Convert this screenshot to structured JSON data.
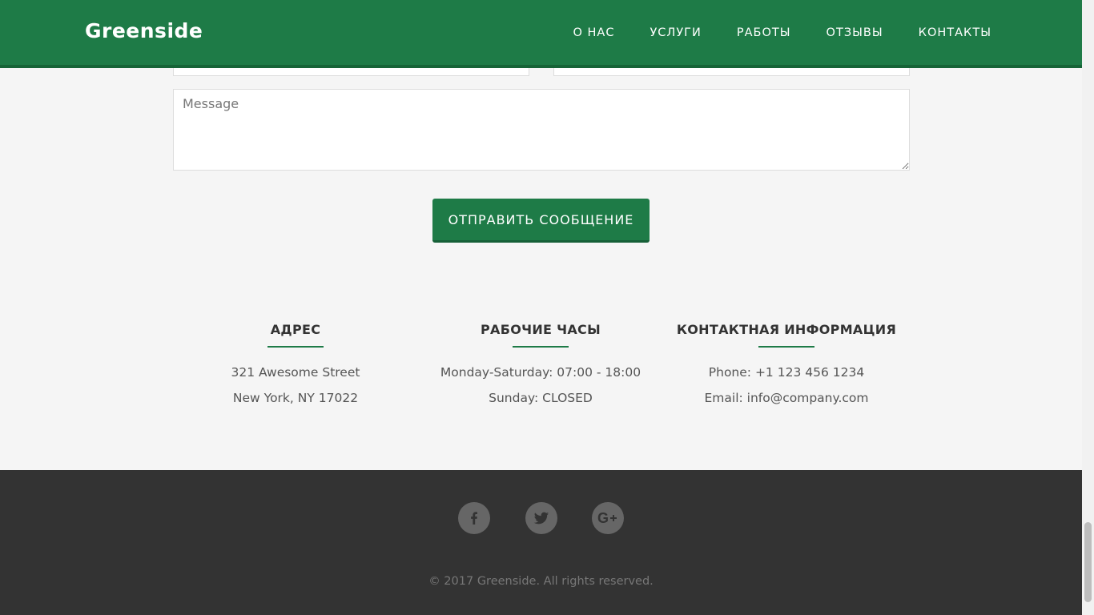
{
  "header": {
    "brand": "Greenside",
    "nav": [
      "О НАС",
      "УСЛУГИ",
      "РАБОТЫ",
      "ОТЗЫВЫ",
      "КОНТАКТЫ"
    ],
    "color": "#1e7b47"
  },
  "form": {
    "message_placeholder": "Message",
    "message_value": "",
    "submit_label": "ОТПРАВИТЬ СООБЩЕНИЕ"
  },
  "info": {
    "address": {
      "title": "АДРЕС",
      "lines": [
        "321 Awesome Street",
        "New York, NY 17022"
      ]
    },
    "hours": {
      "title": "РАБОЧИЕ ЧАСЫ",
      "lines": [
        "Monday-Saturday: 07:00 - 18:00",
        "Sunday: CLOSED"
      ]
    },
    "contact": {
      "title": "КОНТАКТНАЯ ИНФОРМАЦИЯ",
      "lines": [
        "Phone: +1 123 456 1234",
        "Email: info@company.com"
      ]
    }
  },
  "footer": {
    "social": [
      "facebook-icon",
      "twitter-icon",
      "google-plus-icon"
    ],
    "copyright": "© 2017 Greenside. All rights reserved.",
    "background": "#333333"
  }
}
